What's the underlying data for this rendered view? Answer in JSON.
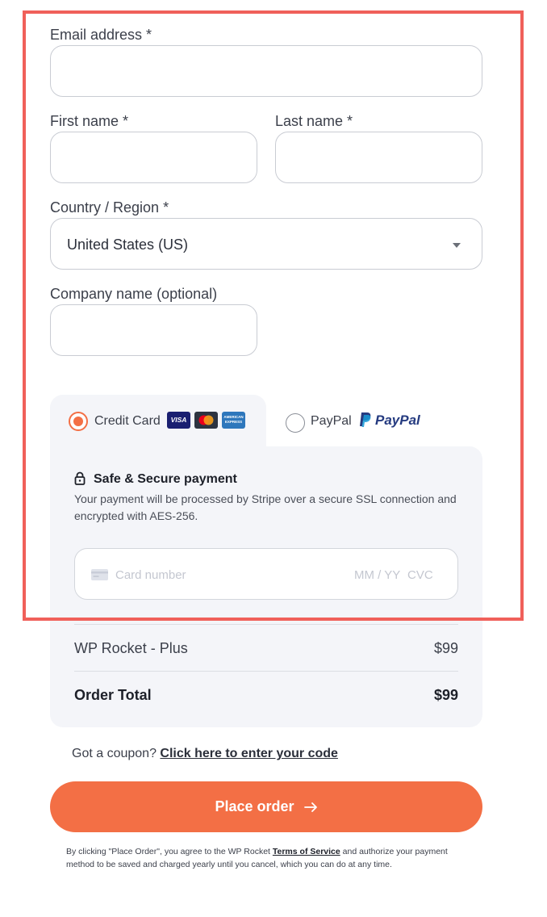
{
  "form": {
    "email_label": "Email address *",
    "email_value": "",
    "first_name_label": "First name *",
    "first_name_value": "",
    "last_name_label": "Last name *",
    "last_name_value": "",
    "country_label": "Country / Region *",
    "country_value": "United States (US)",
    "company_label": "Company name (optional)",
    "company_value": ""
  },
  "payment": {
    "credit_card_label": "Credit Card",
    "credit_card_selected": true,
    "card_icons": [
      "visa-icon",
      "mastercard-icon",
      "amex-icon"
    ],
    "visa_text": "VISA",
    "amex_text": "AMERICAN EXPRESS",
    "paypal_label": "PayPal",
    "paypal_logo_text": "PayPal",
    "secure_title": "Safe & Secure payment",
    "secure_desc": "Your payment will be processed by Stripe over a secure SSL connection and encrypted with AES-256.",
    "card_number_placeholder": "Card number",
    "expiry_placeholder": "MM / YY",
    "cvc_placeholder": "CVC"
  },
  "summary": {
    "product_name": "WP Rocket - Plus",
    "product_price": "$99",
    "total_label": "Order Total",
    "total_price": "$99"
  },
  "coupon": {
    "prompt": "Got a coupon?",
    "link": "Click here to enter your code"
  },
  "order_button": {
    "label": "Place order"
  },
  "terms": {
    "before": "By clicking \"Place Order\", you agree to the WP Rocket ",
    "link": "Terms of Service",
    "after": " and authorize your payment method to be saved and charged yearly until you cancel, which you can do at any time."
  },
  "colors": {
    "accent": "#f36f45",
    "highlight_border": "#f0605a",
    "panel_bg": "#f4f5f9",
    "paypal_dark": "#253b80",
    "paypal_light": "#179bd7"
  }
}
